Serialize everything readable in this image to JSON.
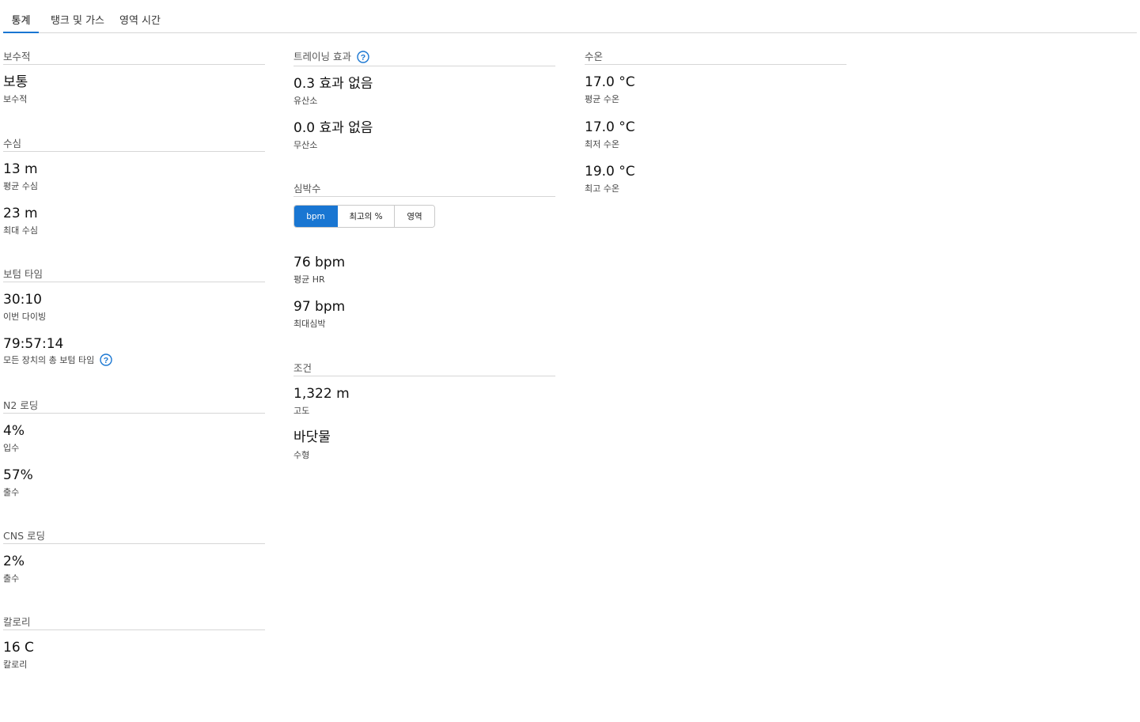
{
  "tabs": [
    {
      "label": "통계"
    },
    {
      "label": "탱크 및 가스"
    },
    {
      "label": "영역 시간"
    }
  ],
  "left": {
    "conservatism": {
      "title": "보수적",
      "value": "보통",
      "label": "보수적"
    },
    "depth": {
      "title": "수심",
      "avg_value": "13 m",
      "avg_label": "평균 수심",
      "max_value": "23 m",
      "max_label": "최대 수심"
    },
    "bottom_time": {
      "title": "보텀 타임",
      "this_value": "30:10",
      "this_label": "이번 다이빙",
      "total_value": "79:57:14",
      "total_label": "모든 장치의 총 보텀 타임"
    },
    "n2": {
      "title": "N2 로딩",
      "in_value": "4%",
      "in_label": "입수",
      "out_value": "57%",
      "out_label": "출수"
    },
    "cns": {
      "title": "CNS 로딩",
      "out_value": "2%",
      "out_label": "출수"
    },
    "calories": {
      "title": "칼로리",
      "value": "16 C",
      "label": "칼로리"
    }
  },
  "middle": {
    "training": {
      "title": "트레이닝 효과",
      "aerobic_value": "0.3 효과 없음",
      "aerobic_label": "유산소",
      "anaerobic_value": "0.0 효과 없음",
      "anaerobic_label": "무산소"
    },
    "heart_rate": {
      "title": "심박수",
      "buttons": [
        "bpm",
        "최고의 %",
        "영역"
      ],
      "avg_value": "76 bpm",
      "avg_label": "평균 HR",
      "max_value": "97 bpm",
      "max_label": "최대심박"
    },
    "conditions": {
      "title": "조건",
      "altitude_value": "1,322 m",
      "altitude_label": "고도",
      "water_value": "바닷물",
      "water_label": "수형"
    }
  },
  "right": {
    "water_temp": {
      "title": "수온",
      "avg_value": "17.0 °C",
      "avg_label": "평균 수온",
      "min_value": "17.0 °C",
      "min_label": "최저 수온",
      "max_value": "19.0 °C",
      "max_label": "최고 수온"
    }
  },
  "colors": {
    "accent": "#1976d2"
  },
  "icons": {
    "help": "help-circle-icon"
  }
}
